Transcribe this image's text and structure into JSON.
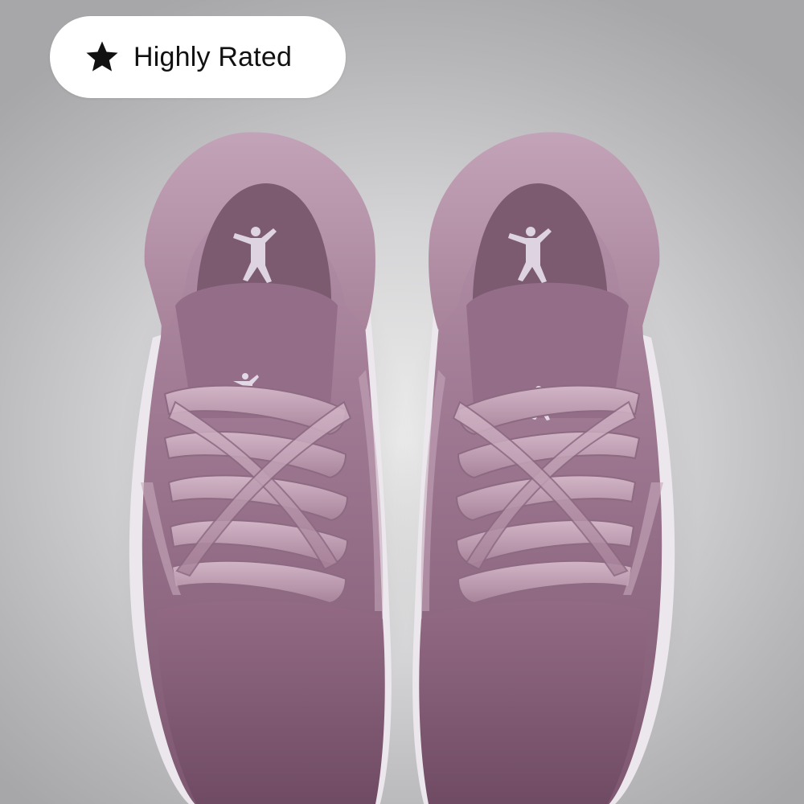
{
  "badge": {
    "label": "Highly Rated",
    "icon": "star-icon"
  },
  "product": {
    "image_subject": "sneaker-pair",
    "colors": {
      "background": "#d4d4d6",
      "upper": "#8a5f79",
      "upper_light": "#b48fa6",
      "lining": "#7d5b70",
      "sole": "#ece8ec",
      "logo": "#dcd2e0"
    }
  }
}
